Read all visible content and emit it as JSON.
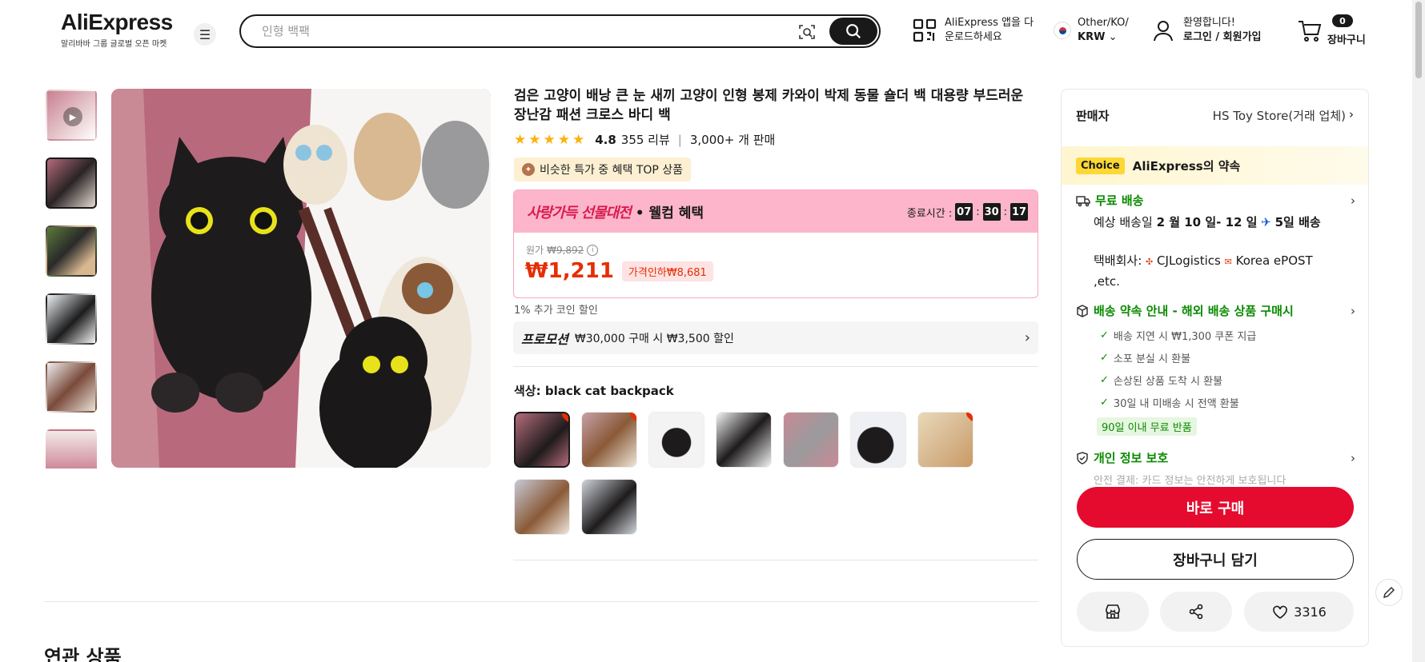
{
  "header": {
    "logo": "AliExpress",
    "logo_sub": "알리바바 그룹 글로벌 오픈 마켓",
    "search_placeholder": "인형 백팩",
    "app_download": "AliExpress 앱을 다운로드하세요",
    "lang_line1": "Other/KO/",
    "lang_line2": "KRW",
    "welcome": "환영합니다!",
    "login": "로그인 / 회원가입",
    "cart_count": "0",
    "cart_label": "장바구니"
  },
  "product": {
    "title": "검은 고양이 배낭 큰 눈 새끼 고양이 인형 봉제 카와이 박제 동물 숄더 백 대용량 부드러운 장난감 패션 크로스 바디 백",
    "rating": "4.8",
    "reviews": "355 리뷰",
    "sold": "3,000+ 개 판매",
    "top_badge": "비슷한 특가 중 혜택 TOP 상품",
    "promo_title": "사랑가득 선물대전",
    "promo_sub": "• 웰컴 혜택",
    "countdown_label": "종료시간 :",
    "countdown": [
      "07",
      "30",
      "17"
    ],
    "orig_label": "원가",
    "orig_price": "₩9,892",
    "price": "₩1,211",
    "discount": "가격인하₩8,681",
    "coin": "1% 추가 코인 할인",
    "promotion_label": "프로모션",
    "promotion_text": "₩30,000 구매 시 ₩3,500 할인",
    "color_label_prefix": "색상: ",
    "color_value": "black cat backpack",
    "related": "연관 상품"
  },
  "panel": {
    "seller_label": "판매자",
    "seller_name": "HS Toy Store(거래 업체)",
    "choice_tag": "Choice",
    "choice_text": "AliExpress의 약속",
    "free_shipping": "무료 배송",
    "delivery_prefix": "예상 배송일",
    "delivery_dates": "2 월 10 일- 12 일",
    "delivery_days": "5일 배송",
    "carrier_label": "택배회사:",
    "carrier1": "CJLogistics",
    "carrier2": "Korea ePOST ,etc.",
    "promise_title": "배송 약속 안내 - 해외 배송 상품 구매시",
    "promises": [
      "배송 지연 시 ₩1,300 쿠폰 지급",
      "소포 분실 시 환불",
      "손상된 상품 도착 시 환불",
      "30일 내 미배송 시 전액 환불"
    ],
    "return_tag": "90일 이내 무료 반품",
    "privacy": "개인 정보 보호",
    "privacy_sub": "안전 결제: 카드 정보는 안전하게 보호됩니다",
    "buy_now": "바로 구매",
    "add_cart": "장바구니 담기",
    "wish_count": "3316"
  }
}
